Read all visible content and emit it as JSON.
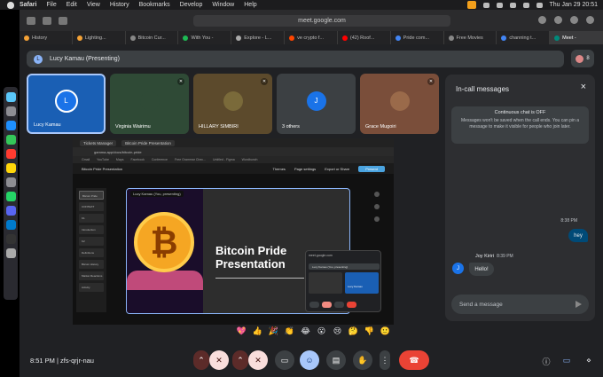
{
  "menubar": {
    "app": "Safari",
    "items": [
      "File",
      "Edit",
      "View",
      "History",
      "Bookmarks",
      "Develop",
      "Window",
      "Help"
    ],
    "clock": "Thu Jan 29  20:51"
  },
  "browser": {
    "url": "meet.google.com",
    "tabs": [
      {
        "label": "History",
        "color": "#f4a236"
      },
      {
        "label": "Lighting...",
        "color": "#f4a236"
      },
      {
        "label": "Bitcoin Cur...",
        "color": "#888888"
      },
      {
        "label": "With You -",
        "color": "#1db954"
      },
      {
        "label": "Explore - L...",
        "color": "#aaaaaa"
      },
      {
        "label": "ve crypto f...",
        "color": "#ff4500"
      },
      {
        "label": "(42) Roof...",
        "color": "#ff0000"
      },
      {
        "label": "Pride com...",
        "color": "#4285f4"
      },
      {
        "label": "Free Movies",
        "color": "#888888"
      },
      {
        "label": "channing t...",
        "color": "#4285f4"
      },
      {
        "label": "Meet -",
        "color": "#00897b"
      }
    ]
  },
  "meet": {
    "presenting_banner": "Lucy Kamau (Presenting)",
    "presenting_initial": "L",
    "people_count": "8",
    "tiles": [
      {
        "name": "Lucy Kamau",
        "initial": "L",
        "bg": "#1a5fb4",
        "avatar_bg": "#1a73e8"
      },
      {
        "name": "Virginia Wairimu",
        "initial": "",
        "bg": "#2f4a36",
        "avatar_bg": "#2f4a36"
      },
      {
        "name": "HILLARY SIMBIRI",
        "initial": "",
        "bg": "#5c4a2c",
        "avatar_bg": "#7a6a3a"
      },
      {
        "name": "3 others",
        "initial": "J",
        "bg": "#3c4043",
        "avatar_bg": "#1a73e8"
      },
      {
        "name": "Grace Mugoiri",
        "initial": "",
        "bg": "#7a4e3a",
        "avatar_bg": "#9a6a4a"
      }
    ],
    "shared_screen": {
      "tabs": [
        "Tickets Manager",
        "Bitcoin Pride Presentation"
      ],
      "url": "gamma.app/docs/bitcoin-pride",
      "bookmarks": [
        "Gmail",
        "YouTube",
        "Maps",
        "Facebook",
        "Conference",
        "Free Grammar Chec...",
        "Untitled - Figma",
        "Wordbunch"
      ],
      "header": "Bitcoin Pride Presentation",
      "header_actions": [
        "Themes",
        "Page settings",
        "Export or Share",
        "Present"
      ],
      "sidebar": [
        "Bitcoin Pride",
        "CONTEXT",
        "K1",
        "Introduction",
        "K2",
        "Definitions",
        "Bitcoin History",
        "Market Reactions",
        "Activity"
      ],
      "slide_title": "Bitcoin Pride Presentation",
      "coin_glyph": "₿",
      "slide_toolbar": "Lucy Kamau (You, presenting)",
      "pip_title": "meet.google.com",
      "pip_banner": "Lucy Kamau (You, presenting)",
      "pip_name": "Lucy Kamau"
    },
    "reactions": [
      "💖",
      "👍",
      "🎉",
      "👏",
      "😂",
      "😮",
      "😢",
      "🤔",
      "👎",
      "🙂"
    ],
    "chat": {
      "title": "In-call messages",
      "close": "×",
      "notice_title": "Continuous chat is OFF",
      "notice_body": "Messages won't be saved when the call ends. You can pin a message to make it visible for people who join later.",
      "messages": [
        {
          "time": "8:38 PM",
          "text": "hey"
        },
        {
          "sender": "Joy Kiriri",
          "initial": "J",
          "time": "8:39 PM",
          "text": "Hello!"
        }
      ],
      "input_placeholder": "Send a message"
    },
    "bottom": {
      "time_code": "8:51 PM  |  zfs-qrjr-nau"
    }
  }
}
